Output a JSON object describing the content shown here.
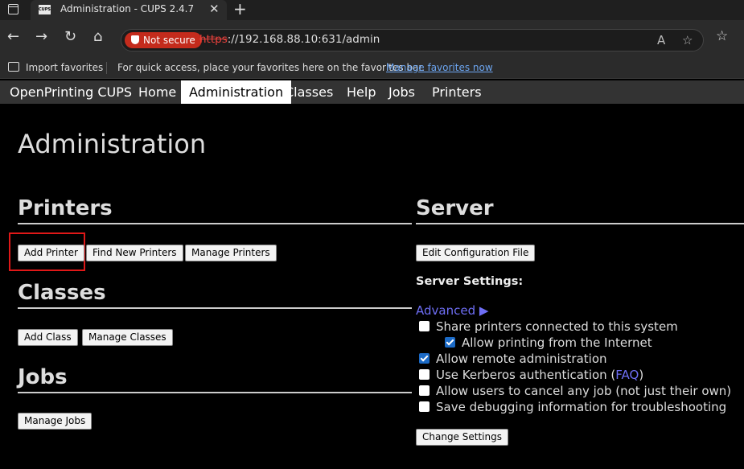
{
  "browser": {
    "tab_title": "Administration - CUPS 2.4.7",
    "tab_favicon_text": "CUPS",
    "not_secure": "Not secure",
    "url_scheme": "https",
    "url_rest": "://192.168.88.10:631/admin",
    "favorites": {
      "import": "Import favorites",
      "hint": "For quick access, place your favorites here on the favorites bar.",
      "manage_link": "Manage favorites now"
    }
  },
  "nav": {
    "items": [
      "OpenPrinting CUPS",
      "Home",
      "Administration",
      "Classes",
      "Help",
      "Jobs",
      "Printers"
    ],
    "active": "Administration"
  },
  "page": {
    "title": "Administration",
    "printers": {
      "heading": "Printers",
      "buttons": [
        "Add Printer",
        "Find New Printers",
        "Manage Printers"
      ]
    },
    "classes": {
      "heading": "Classes",
      "buttons": [
        "Add Class",
        "Manage Classes"
      ]
    },
    "jobs": {
      "heading": "Jobs",
      "buttons": [
        "Manage Jobs"
      ]
    },
    "server": {
      "heading": "Server",
      "edit_config": "Edit Configuration File",
      "settings_label": "Server Settings:",
      "advanced": "Advanced ▶",
      "options": [
        {
          "label": "Share printers connected to this system",
          "checked": false
        },
        {
          "label": "Allow printing from the Internet",
          "checked": true
        },
        {
          "label": "Allow remote administration",
          "checked": true
        },
        {
          "label_prefix": "Use Kerberos authentication (",
          "link": "FAQ",
          "label_suffix": ")",
          "checked": false
        },
        {
          "label": "Allow users to cancel any job (not just their own)",
          "checked": false
        },
        {
          "label": "Save debugging information for troubleshooting",
          "checked": false
        }
      ],
      "change_settings": "Change Settings"
    }
  },
  "colors": {
    "background": "#000000",
    "nav_bg": "#333333",
    "link": "#6e6ef5",
    "highlight": "#e01818",
    "not_secure": "#c42b1c"
  }
}
